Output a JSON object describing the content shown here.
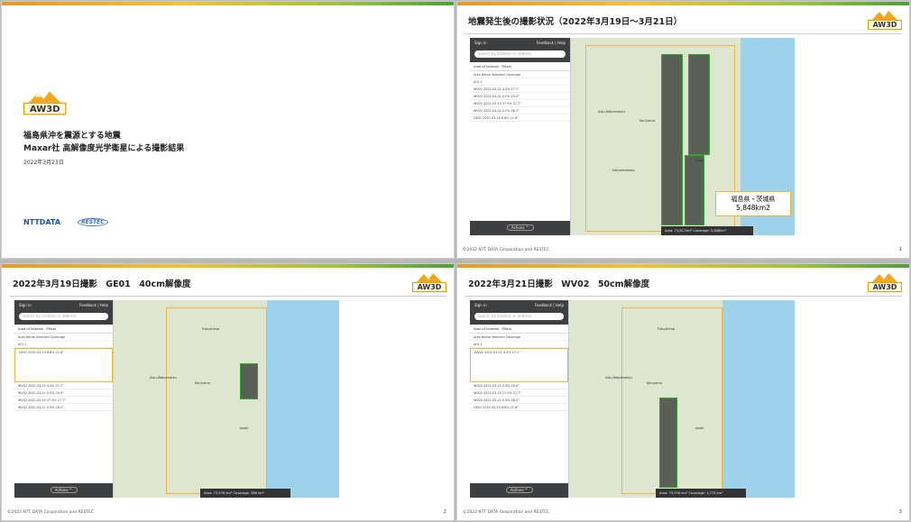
{
  "cover": {
    "logo_text": "AW3D",
    "title_line1": "福島県沖を震源とする地震",
    "title_line2": "Maxar社 高解像度光学衛星による撮影結果",
    "date": "2022年3月23日",
    "brand1": "NTTDATA",
    "brand2": "RESTEC"
  },
  "slides": [
    {
      "title": "地震発生後の撮影状況（2022年3月19日～3月21日）",
      "logo_text": "AW3D",
      "footer": "©2022 NTT DATA Corporation and RESTEC",
      "page": "1",
      "callout_line1": "福島県・茨城県",
      "callout_line2": "5,848km2",
      "status": "Area: 73,817km² Coverage: 5,848km²"
    },
    {
      "title": "2022年3月19日撮影　GE01　40cm解像度",
      "logo_text": "AW3D",
      "footer": "©2022 NTT DATA Corporation and RESTEC",
      "page": "2",
      "status": "Area: 73,576 km² Coverage: 386 km²"
    },
    {
      "title": "2022年3月21日撮影　WV02　50cm解像度",
      "logo_text": "AW3D",
      "footer": "©2022 NTT DATA Corporation and RESTEC",
      "page": "3",
      "status": "Area: 73,576 km² Coverage: 1,775 km²"
    }
  ],
  "panel": {
    "sign_in": "Sign in",
    "feedback": "Feedback | Help",
    "search_placeholder": "Search by location or address",
    "area_of_interest": "Area of Interest",
    "filters": "Filters",
    "header_row": "Area Name      Selected  Coverage",
    "aoi_row": "AOI 1",
    "activate": "Actions ^",
    "rows_overview": [
      "WV02  2022-03-21  4.4%  27.1°",
      "WV02  2022-03-21  0.0%  29.0°",
      "WV02  2022-03-19  27.5%  27.7°",
      "WV02  2022-03-21  0.0%  28.2°",
      "GE01  2022-03-19  8.8%  21.6°"
    ],
    "rows_ge01": [
      "GE01  2022-03-19  8.8%  21.6°",
      "WV02  2022-03-21  4.4%  27.1°",
      "WV02  2022-03-21  0.0%  29.0°",
      "WV02  2022-03-19  27.5%  27.7°",
      "WV02  2022-03-21  0.0%  28.2°"
    ],
    "rows_wv02": [
      "WV02  2022-03-21  4.4%  27.1°",
      "WV02  2022-03-21  0.0%  29.0°",
      "WV02  2022-03-19  27.5%  27.7°",
      "WV02  2022-03-21  0.0%  28.2°",
      "GE01  2022-03-19  8.8%  21.6°"
    ]
  },
  "towns": {
    "koriyama": "Koriyama",
    "fukushima": "Fukushima",
    "iwaki": "Iwaki",
    "aizu": "Aizu-Wakamatsu",
    "nasushiobara": "Nasushiobara",
    "hitachi": "Hitachi"
  }
}
